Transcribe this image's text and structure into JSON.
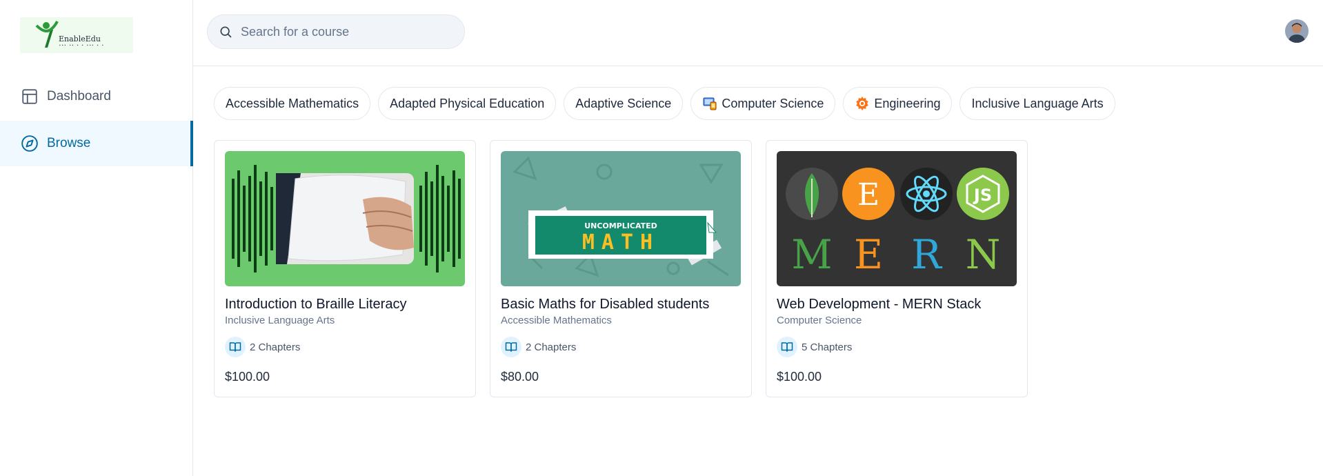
{
  "brand": {
    "logo_text": "EnableEdu",
    "accent": "#0369a1"
  },
  "sidebar": {
    "items": [
      {
        "label": "Dashboard",
        "icon": "layout-icon",
        "active": false
      },
      {
        "label": "Browse",
        "icon": "compass-icon",
        "active": true
      }
    ]
  },
  "search": {
    "placeholder": "Search for a course",
    "value": ""
  },
  "categories": [
    {
      "label": "Accessible Mathematics",
      "icon": ""
    },
    {
      "label": "Adapted Physical Education",
      "icon": ""
    },
    {
      "label": "Adaptive Science",
      "icon": ""
    },
    {
      "label": "Computer Science",
      "icon": "computer-icon"
    },
    {
      "label": "Engineering",
      "icon": "gear-icon"
    },
    {
      "label": "Inclusive Language Arts",
      "icon": ""
    }
  ],
  "courses": [
    {
      "title": "Introduction to Braille Literacy",
      "category": "Inclusive Language Arts",
      "chapters": "2 Chapters",
      "price": "$100.00"
    },
    {
      "title": "Basic Maths for Disabled students",
      "category": "Accessible Mathematics",
      "chapters": "2 Chapters",
      "price": "$80.00",
      "thumb_text_top": "UNCOMPLICATED",
      "thumb_text_main": "MATH"
    },
    {
      "title": "Web Development - MERN Stack",
      "category": "Computer Science",
      "chapters": "5 Chapters",
      "price": "$100.00",
      "thumb_letters": [
        "M",
        "E",
        "R",
        "N"
      ],
      "thumb_js": "JS"
    }
  ]
}
